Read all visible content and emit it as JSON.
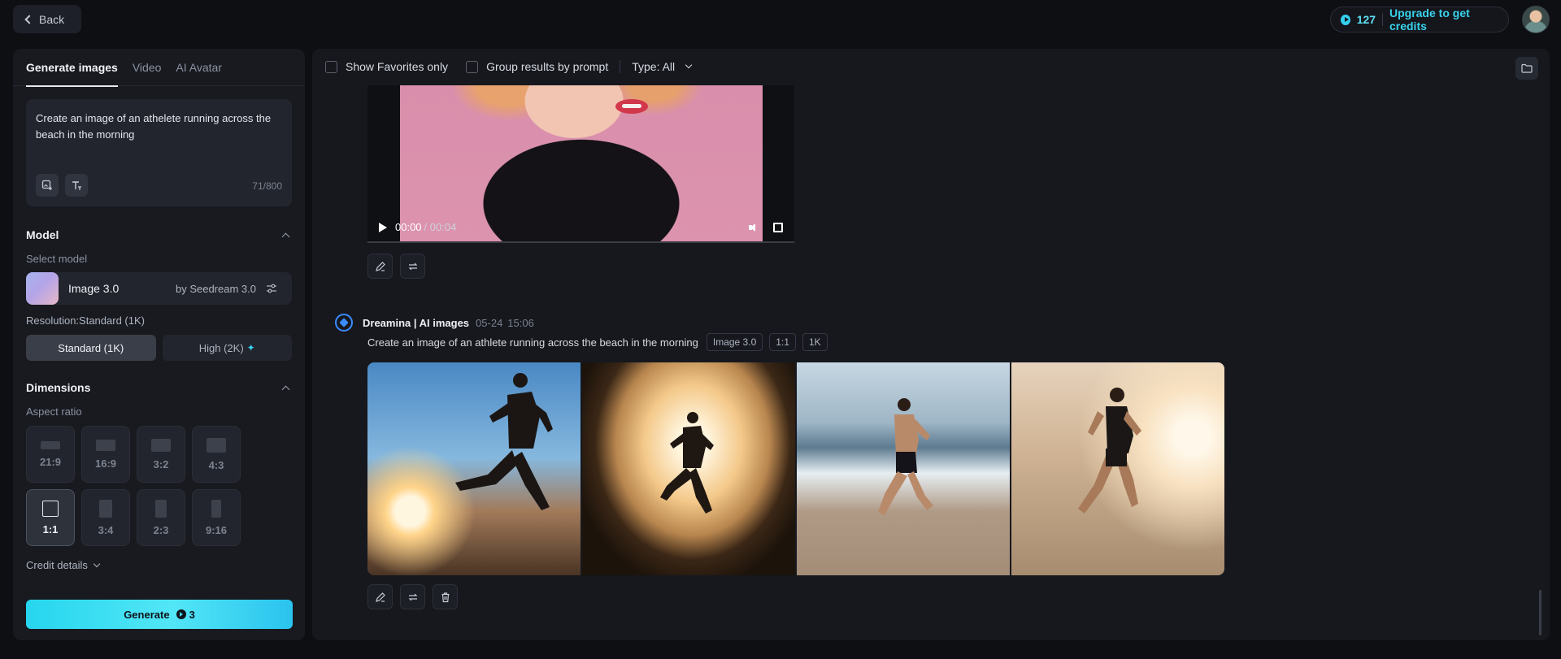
{
  "header": {
    "back_label": "Back",
    "credits_count": "127",
    "upgrade_label": "Upgrade to get credits"
  },
  "left_panel": {
    "tabs": [
      {
        "label": "Generate images",
        "active": true
      },
      {
        "label": "Video",
        "active": false
      },
      {
        "label": "AI Avatar",
        "active": false
      }
    ],
    "prompt": {
      "text": "Create an image of an athelete running across the beach in the morning",
      "char_count": "71/800"
    },
    "model_section": {
      "title": "Model",
      "select_label": "Select model",
      "model_name": "Image 3.0",
      "model_by": "by Seedream 3.0"
    },
    "resolution": {
      "label": "Resolution:Standard (1K)",
      "options": [
        {
          "label": "Standard (1K)",
          "selected": true
        },
        {
          "label": "High (2K)",
          "selected": false
        }
      ]
    },
    "dimensions": {
      "title": "Dimensions",
      "aspect_label": "Aspect ratio",
      "ratios": [
        "21:9",
        "16:9",
        "3:2",
        "4:3",
        "1:1",
        "3:4",
        "2:3",
        "9:16"
      ],
      "selected_ratio": "1:1"
    },
    "credit_details_label": "Credit details",
    "generate": {
      "label": "Generate",
      "cost": "3"
    }
  },
  "main": {
    "filters": {
      "favorites_label": "Show Favorites only",
      "group_label": "Group results by prompt",
      "type_label": "Type: All"
    },
    "video": {
      "current_time": "00:00",
      "total_time": "/ 00:04"
    },
    "result": {
      "source": "Dreamina | AI images",
      "date": "05-24",
      "time": "15:06",
      "prompt": "Create an image of an athlete running across the beach in the morning",
      "chips": [
        "Image 3.0",
        "1:1",
        "1K"
      ]
    }
  },
  "colors": {
    "accent": "#35d0f0",
    "background": "#0e0f13",
    "panel": "#181a20"
  }
}
